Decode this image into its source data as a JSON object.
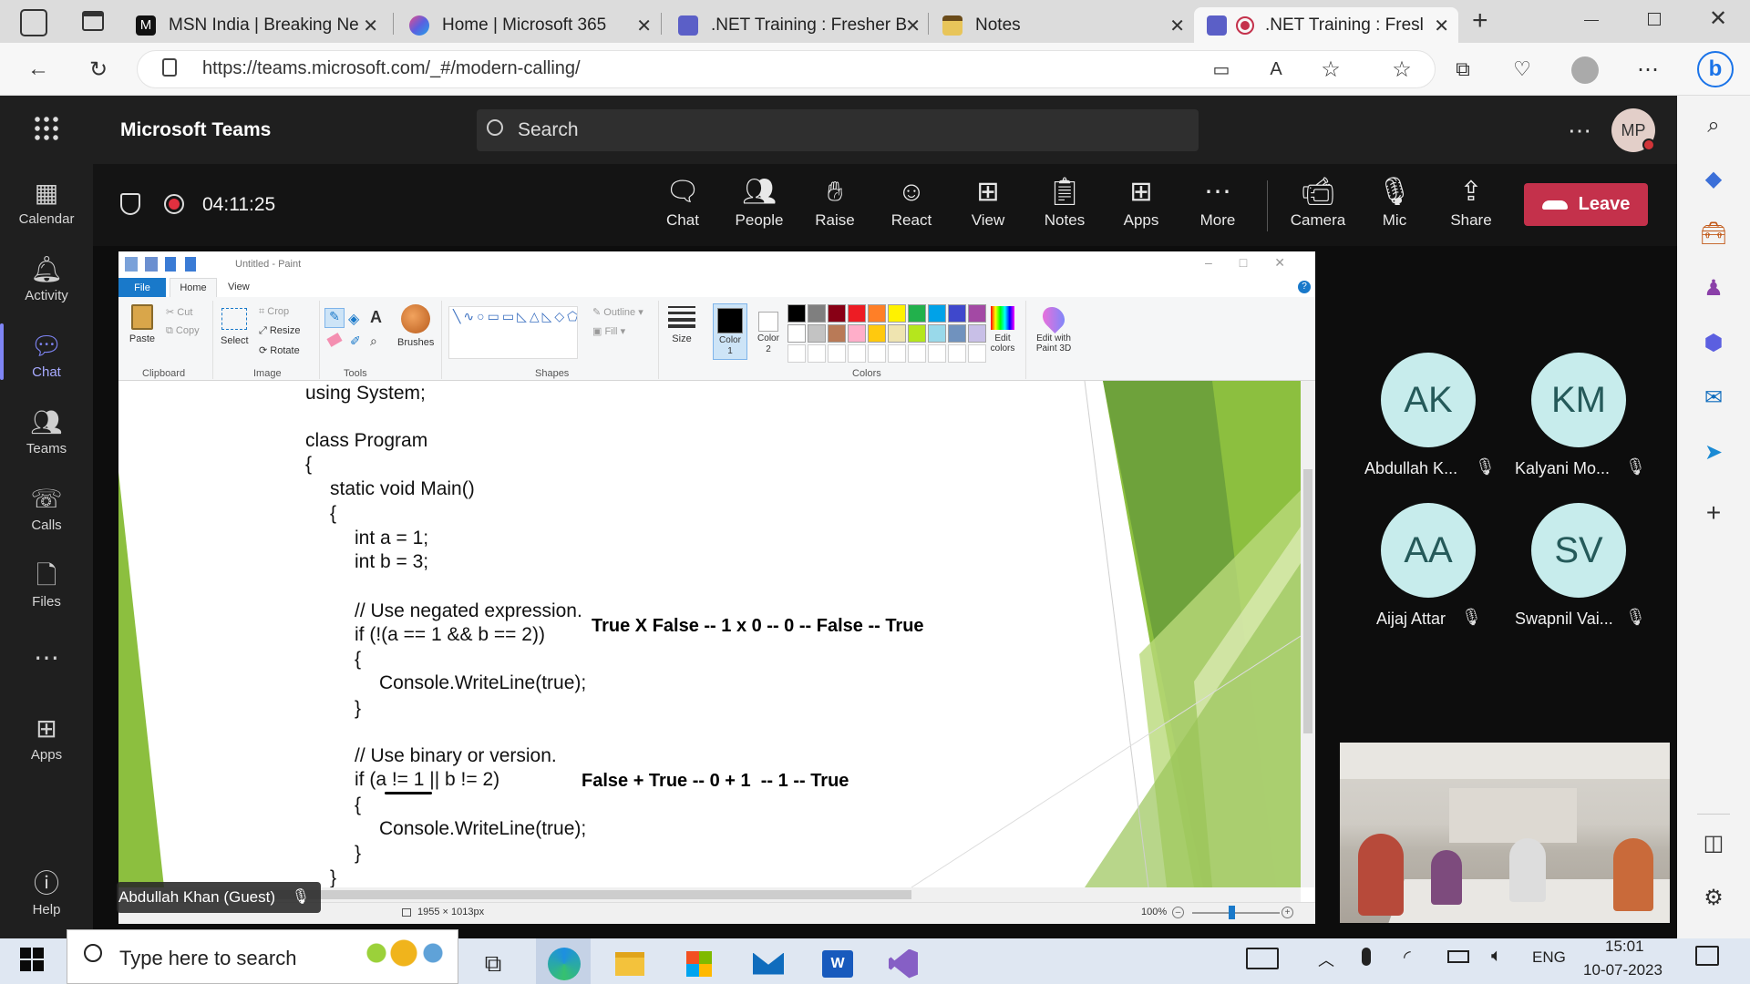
{
  "browser": {
    "tabs": [
      {
        "title": "MSN India | Breaking Ne",
        "icon": "msn-icon"
      },
      {
        "title": "Home | Microsoft 365",
        "icon": "m365-icon"
      },
      {
        "title": ".NET Training : Fresher B",
        "icon": "teams-icon"
      },
      {
        "title": "Notes",
        "icon": "notes-icon"
      },
      {
        "title": ".NET Training : Fresl",
        "icon": "teams-icon"
      }
    ],
    "url": "https://teams.microsoft.com/_#/modern-calling/"
  },
  "teams": {
    "app_title": "Microsoft Teams",
    "search_placeholder": "Search",
    "avatar_initials": "MP",
    "rail": [
      {
        "label": "Calendar",
        "icon": "calendar-icon"
      },
      {
        "label": "Activity",
        "icon": "bell-icon"
      },
      {
        "label": "Chat",
        "icon": "chat-icon"
      },
      {
        "label": "Teams",
        "icon": "teams-icon"
      },
      {
        "label": "Calls",
        "icon": "phone-icon"
      },
      {
        "label": "Files",
        "icon": "file-icon"
      },
      {
        "label": "Apps",
        "icon": "apps-icon"
      },
      {
        "label": "Help",
        "icon": "help-icon"
      }
    ],
    "meeting": {
      "timer": "04:11:25",
      "controls": [
        "Chat",
        "People",
        "Raise",
        "React",
        "View",
        "Notes",
        "Apps",
        "More",
        "Camera",
        "Mic",
        "Share"
      ],
      "leave_label": "Leave"
    },
    "participants": [
      {
        "initials": "AK",
        "name": "Abdullah K..."
      },
      {
        "initials": "KM",
        "name": "Kalyani Mo..."
      },
      {
        "initials": "AA",
        "name": "Aijaj Attar"
      },
      {
        "initials": "SV",
        "name": "Swapnil Vai..."
      }
    ],
    "presenter_label": "Abdullah Khan (Guest)"
  },
  "paint": {
    "title": "Untitled - Paint",
    "tabs": [
      "File",
      "Home",
      "View"
    ],
    "groups": [
      "Clipboard",
      "Image",
      "Tools",
      "Shapes",
      "Colors"
    ],
    "clipboard": {
      "paste": "Paste",
      "cut": "Cut",
      "copy": "Copy"
    },
    "image": {
      "select": "Select",
      "crop": "Crop",
      "resize": "Resize",
      "rotate": "Rotate"
    },
    "brushes": "Brushes",
    "outline": "Outline",
    "fill": "Fill",
    "size": "Size",
    "color1": "Color 1",
    "color2": "Color 2",
    "edit_colors": "Edit colors",
    "edit_3d": "Edit with Paint 3D",
    "palette": [
      "#000000",
      "#7f7f7f",
      "#880015",
      "#ed1c24",
      "#ff7f27",
      "#fff200",
      "#22b14c",
      "#00a2e8",
      "#3f48cc",
      "#a349a4",
      "#ffffff",
      "#c3c3c3",
      "#b97a57",
      "#ffaec9",
      "#ffc90e",
      "#efe4b0",
      "#b5e61d",
      "#99d9ea",
      "#7092be",
      "#c8bfe7"
    ],
    "code_lines": [
      "using System;",
      "class Program",
      "{",
      "static void Main()",
      "{",
      "int a = 1;",
      "int b = 3;",
      "// Use negated expression.",
      "if (!(a == 1 && b == 2))",
      "{",
      "Console.WriteLine(true);",
      "}",
      "// Use binary or version.",
      "if (a != 1 || b != 2)",
      "{",
      "Console.WriteLine(true);",
      "}",
      "}"
    ],
    "annotation1": "True X False -- 1 x 0 -- 0 -- False -- True",
    "annotation2": "False + True -- 0 + 1  -- 1 -- True",
    "dimensions": "1955 × 1013px",
    "zoom": "100%"
  },
  "taskbar": {
    "search_placeholder": "Type here to search",
    "language": "ENG",
    "time": "15:01",
    "date": "10-07-2023"
  }
}
